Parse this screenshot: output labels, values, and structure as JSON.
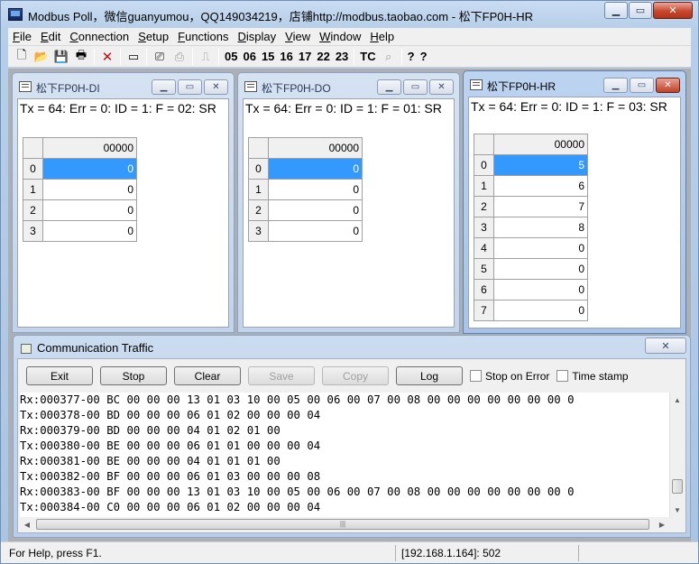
{
  "window": {
    "title": "Modbus Poll，微信guanyumou，QQ149034219，店铺http://modbus.taobao.com - 松下FP0H-HR",
    "minimize": "▁",
    "maximize": "▭",
    "close": "✕"
  },
  "menu": [
    "File",
    "Edit",
    "Connection",
    "Setup",
    "Functions",
    "Display",
    "View",
    "Window",
    "Help"
  ],
  "toolbar": {
    "new": "🗋",
    "open": "📂",
    "save": "💾",
    "print": "🖶",
    "delete": "✕",
    "window": "▭",
    "read": "⎚",
    "print2": "⎙",
    "pulse": "⎍",
    "func_codes": [
      "05",
      "06",
      "15",
      "16",
      "17",
      "22",
      "23"
    ],
    "tc": "TC",
    "tc_icon": "⌕",
    "help": "?",
    "help_ctx": "?"
  },
  "children": [
    {
      "title": "松下FP0H-DI",
      "status": "Tx = 64: Err = 0: ID = 1: F = 02: SR",
      "header": "00000",
      "rows": [
        "0",
        "1",
        "2",
        "3"
      ],
      "values": [
        "0",
        "0",
        "0",
        "0"
      ]
    },
    {
      "title": "松下FP0H-DO",
      "status": "Tx = 64: Err = 0: ID = 1: F = 01: SR",
      "header": "00000",
      "rows": [
        "0",
        "1",
        "2",
        "3"
      ],
      "values": [
        "0",
        "0",
        "0",
        "0"
      ]
    },
    {
      "title": "松下FP0H-HR",
      "status": "Tx = 64: Err = 0: ID = 1: F = 03: SR",
      "header": "00000",
      "rows": [
        "0",
        "1",
        "2",
        "3",
        "4",
        "5",
        "6",
        "7"
      ],
      "values": [
        "5",
        "6",
        "7",
        "8",
        "0",
        "0",
        "0",
        "0"
      ]
    }
  ],
  "child_buttons": {
    "minimize": "▁",
    "restore": "▭",
    "close": "✕"
  },
  "traffic": {
    "title": "Communication Traffic",
    "close": "✕",
    "buttons": {
      "exit": "Exit",
      "stop": "Stop",
      "clear": "Clear",
      "save": "Save",
      "copy": "Copy",
      "log": "Log"
    },
    "stop_on_error": "Stop on Error",
    "time_stamp": "Time stamp",
    "lines": [
      "Rx:000377-00 BC 00 00 00 13 01 03 10 00 05 00 06 00 07 00 08 00 00 00 00 00 00 00 0",
      "Tx:000378-00 BD 00 00 00 06 01 02 00 00 00 04",
      "Rx:000379-00 BD 00 00 00 04 01 02 01 00",
      "Tx:000380-00 BE 00 00 00 06 01 01 00 00 00 04",
      "Rx:000381-00 BE 00 00 00 04 01 01 01 00",
      "Tx:000382-00 BF 00 00 00 06 01 03 00 00 00 08",
      "Rx:000383-00 BF 00 00 00 13 01 03 10 00 05 00 06 00 07 00 08 00 00 00 00 00 00 00 0",
      "Tx:000384-00 C0 00 00 00 06 01 02 00 00 00 04"
    ],
    "scroll_up": "▲",
    "scroll_down": "▼",
    "scroll_left": "◀",
    "scroll_right": "▶",
    "grip": "|||"
  },
  "status": {
    "help": "For Help, press F1.",
    "address": "[192.168.1.164]: 502"
  }
}
